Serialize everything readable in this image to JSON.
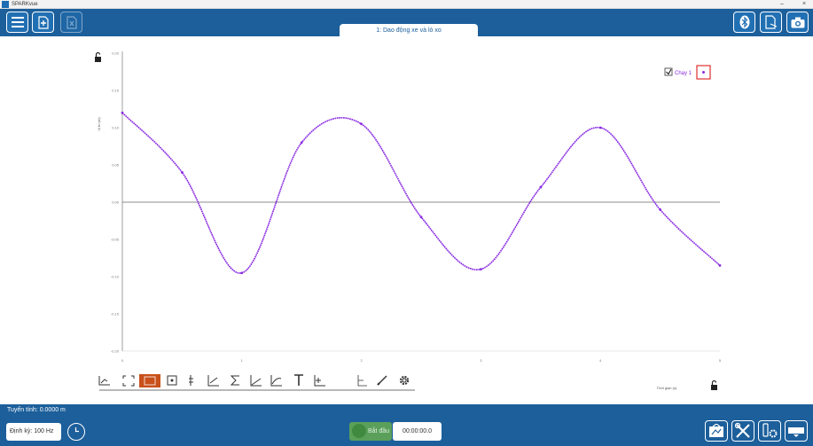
{
  "window": {
    "title": "SPARKvue",
    "minimize_glyph": "–",
    "close_glyph": "×"
  },
  "toolbar": {
    "menu_icon": "hamburger-menu-icon",
    "new_icon": "add-page-icon",
    "delete_icon": "delete-page-icon",
    "bluetooth_icon": "bluetooth-icon",
    "export_icon": "export-icon",
    "camera_icon": "camera-icon"
  },
  "tab": {
    "title": "1: Dao động xe và lò xo"
  },
  "graph": {
    "y_axis_label": "Vị trí (m)",
    "x_axis_label": "Thời gian (s)",
    "legend_label": "Chạy 1",
    "legend_checked": true,
    "lock_icon": "lock-open-icon",
    "tools": [
      "scale-tool-icon",
      "fit-tool-icon",
      "highlight-tool-icon",
      "crosshair-tool-icon",
      "coordinates-tool-icon",
      "slope-tool-icon",
      "statistics-tool-icon",
      "area-tool-icon",
      "curve-fit-tool-icon",
      "annotation-tool-icon",
      "add-plot-icon",
      "delta-tool-icon",
      "draw-tool-icon",
      "settings-icon"
    ]
  },
  "chart_data": {
    "type": "line",
    "title": "",
    "xlabel": "Thời gian (s)",
    "ylabel": "Vị trí (m)",
    "ylim": [
      -0.2,
      0.2
    ],
    "xlim": [
      0,
      5
    ],
    "y_ticks": [
      "0.20",
      "0.15",
      "0.10",
      "0.05",
      "0.00",
      "-0.05",
      "-0.10",
      "-0.15",
      "-0.20"
    ],
    "x_ticks": [
      "0",
      "1",
      "2",
      "3",
      "4",
      "5"
    ],
    "grid": false,
    "legend": "top-right",
    "series": [
      {
        "name": "Chạy 1",
        "color": "#8a2be2",
        "x": [
          0.0,
          0.5,
          1.0,
          1.5,
          2.0,
          2.5,
          3.0,
          3.5,
          4.0,
          4.5,
          5.0
        ],
        "y": [
          0.12,
          0.04,
          -0.095,
          0.08,
          0.105,
          -0.02,
          -0.09,
          0.02,
          0.1,
          -0.01,
          -0.085
        ]
      }
    ]
  },
  "bottom": {
    "fit_label": "Tuyến tính: 0.0000 m",
    "freq_label": "Định kỳ: 100 Hz",
    "start_label": "Bắt đầu",
    "time_value": "00:00:00.0",
    "journal_icon": "journal-icon",
    "tools_icon": "tools-icon",
    "sensor_settings_icon": "sensor-settings-icon",
    "data_summary_icon": "data-summary-icon"
  }
}
